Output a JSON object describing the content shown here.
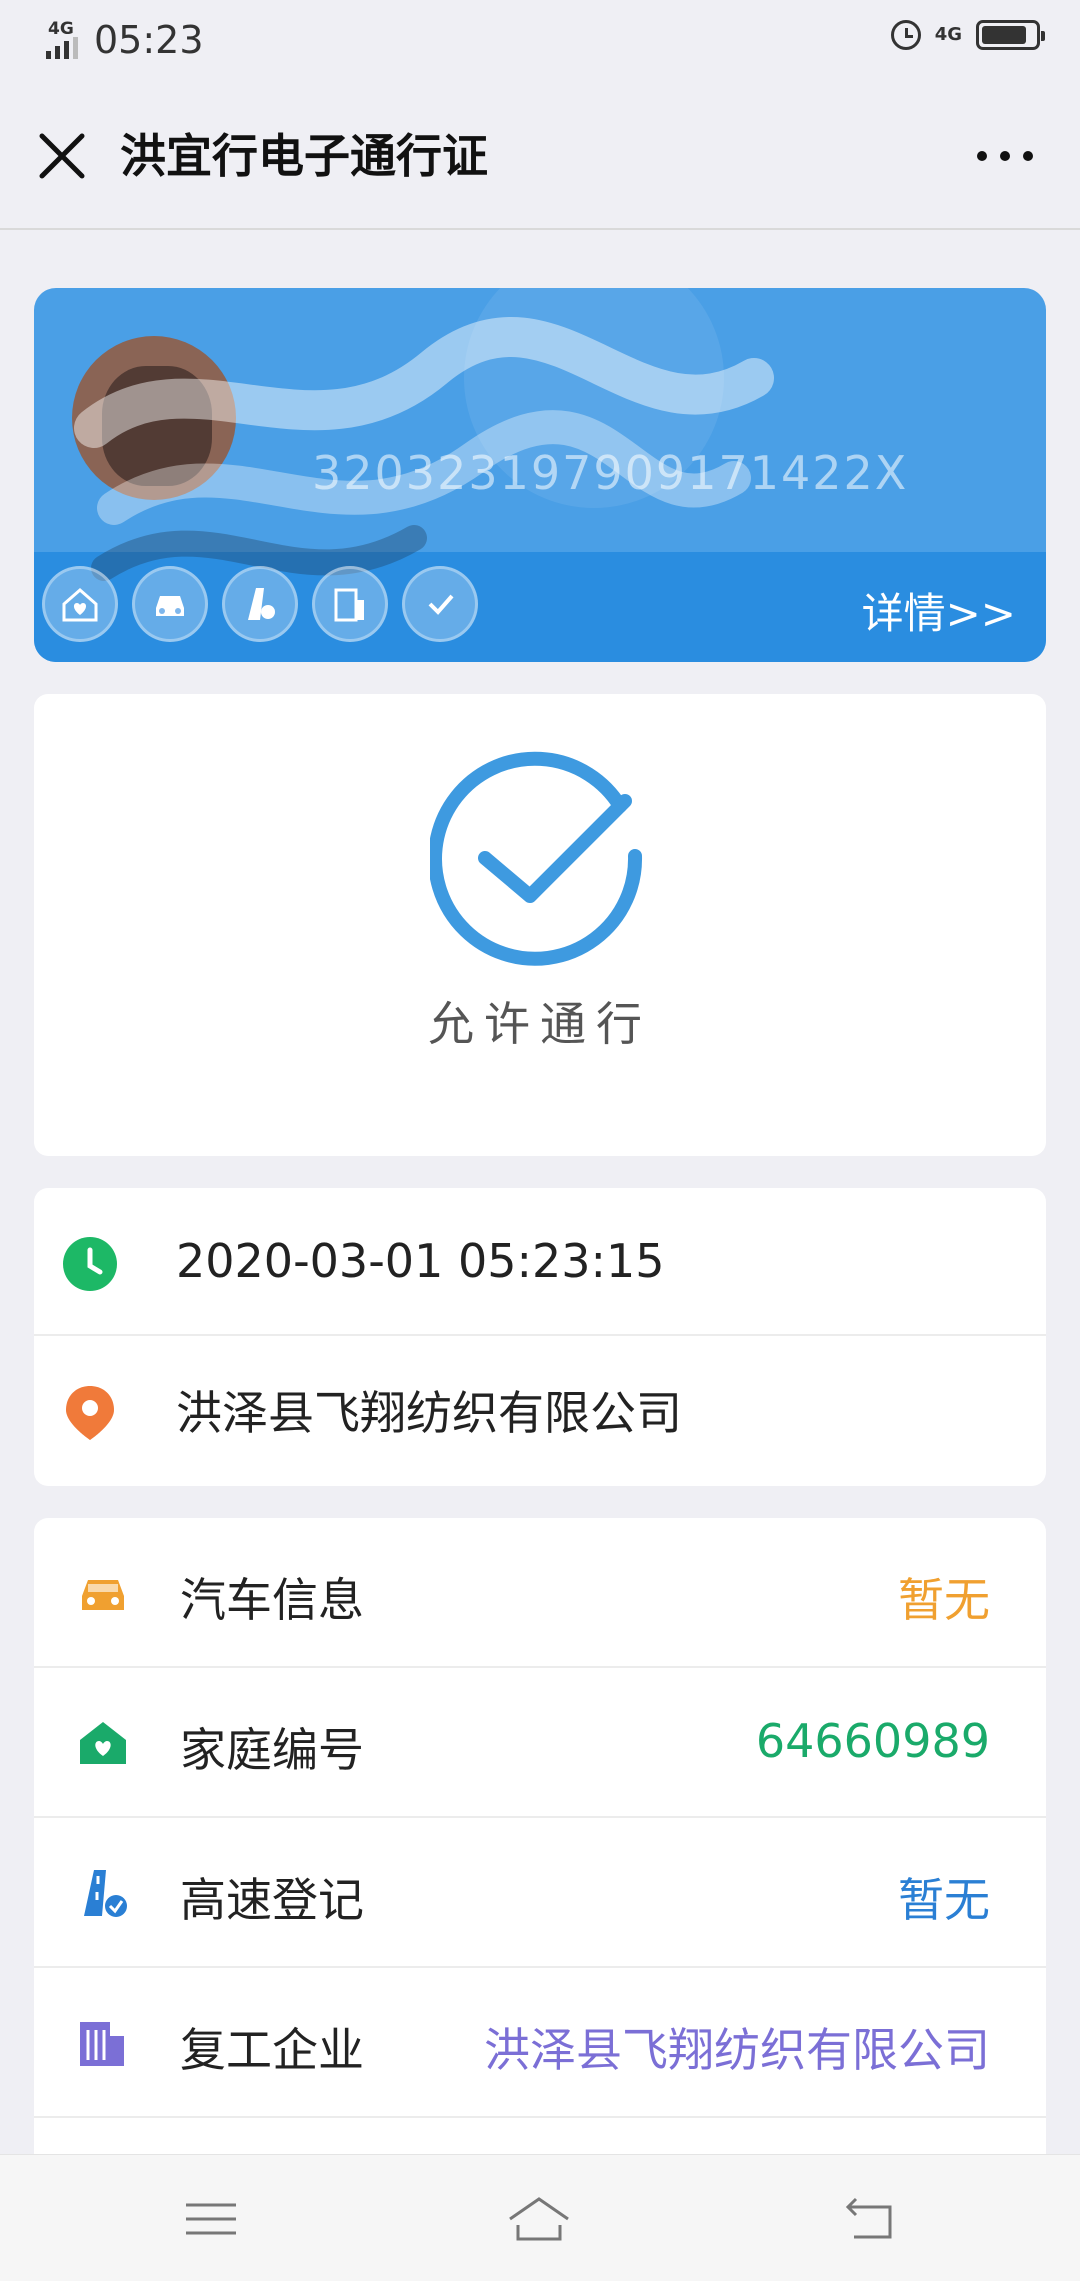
{
  "status_bar": {
    "network": "4G",
    "time": "05:23",
    "network_right": "4G",
    "battery_level": 0.85
  },
  "nav": {
    "title": "洪宜行电子通行证"
  },
  "id_card": {
    "id_number": "320323197909171422X",
    "details_link": "详情>>",
    "icons": [
      "home-heart-icon",
      "car-icon",
      "highway-icon",
      "building-icon",
      "check-shield-icon"
    ]
  },
  "pass_status": {
    "text": "允许通行"
  },
  "checkin": {
    "datetime": "2020-03-01 05:23:15",
    "location": "洪泽县飞翔纺织有限公司"
  },
  "details": {
    "rows": [
      {
        "label": "汽车信息",
        "value": "暂无",
        "color": "#f0a030",
        "icon": "car-icon"
      },
      {
        "label": "家庭编号",
        "value": "64660989",
        "color": "#1aaa6a",
        "icon": "home-heart-icon"
      },
      {
        "label": "高速登记",
        "value": "暂无",
        "color": "#2a7fd4",
        "icon": "highway-icon"
      },
      {
        "label": "复工企业",
        "value": "洪泽县飞翔纺织有限公司",
        "color": "#7b6fd6",
        "icon": "building-icon"
      }
    ]
  },
  "colors": {
    "card_blue": "#4a9fe6",
    "check_blue": "#3e9ae0",
    "clock_green": "#1db866",
    "pin_orange": "#f07a3a"
  }
}
